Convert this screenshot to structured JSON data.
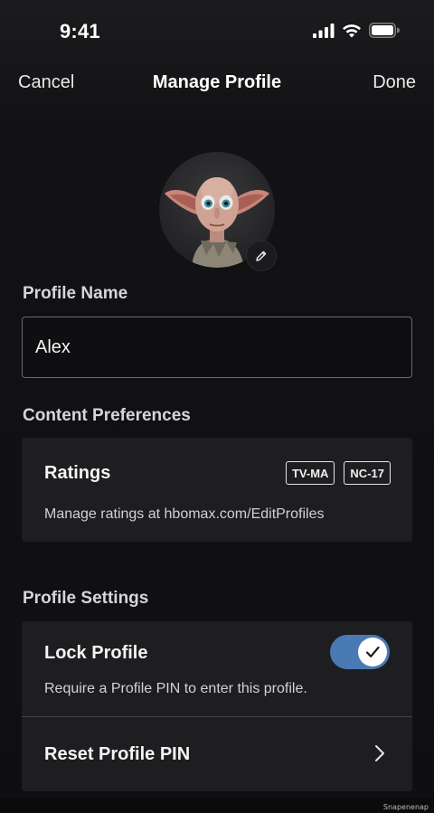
{
  "status": {
    "time": "9:41"
  },
  "nav": {
    "cancel_label": "Cancel",
    "title": "Manage Profile",
    "done_label": "Done"
  },
  "avatar": {
    "icon": "character-avatar",
    "edit_icon": "pencil-icon"
  },
  "profile_name": {
    "label": "Profile Name",
    "value": "Alex",
    "placeholder": ""
  },
  "content_preferences": {
    "label": "Content Preferences",
    "ratings": {
      "title": "Ratings",
      "badges": [
        "TV-MA",
        "NC-17"
      ],
      "note": "Manage ratings at hbomax.com/EditProfiles"
    }
  },
  "profile_settings": {
    "label": "Profile Settings",
    "lock": {
      "title": "Lock Profile",
      "description": "Require a Profile PIN to enter this profile.",
      "enabled": true
    },
    "reset": {
      "title": "Reset Profile PIN"
    }
  },
  "watermark": "Snapenenap",
  "colors": {
    "background": "#0f0f11",
    "card": "#1e1e21",
    "toggle_on": "#4a7ab3"
  }
}
